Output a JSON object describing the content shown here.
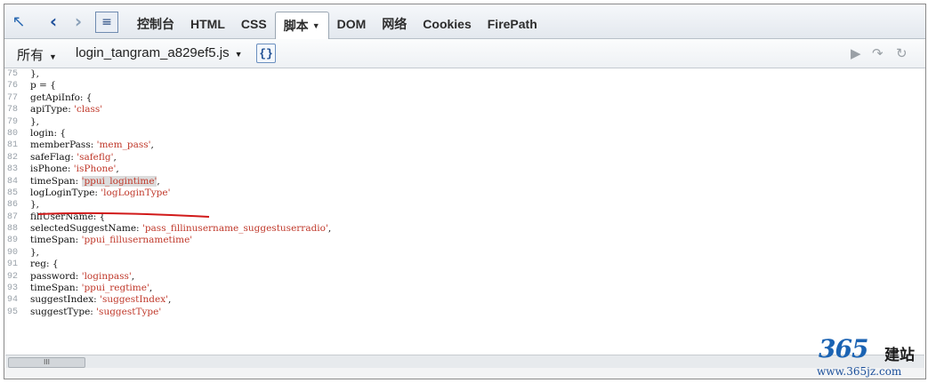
{
  "toolbar": {
    "icons": [
      "inspect-icon",
      "back-icon",
      "forward-icon",
      "command-line-icon"
    ],
    "tabs": [
      {
        "label": "控制台"
      },
      {
        "label": "HTML"
      },
      {
        "label": "CSS"
      },
      {
        "label": "脚本"
      },
      {
        "label": "DOM"
      },
      {
        "label": "网络"
      },
      {
        "label": "Cookies"
      },
      {
        "label": "FirePath"
      }
    ],
    "active_tab": "脚本"
  },
  "scriptbar": {
    "filter_label": "所有",
    "file_name": "login_tangram_a829ef5.js",
    "pretty_print_label": "{}",
    "controls": [
      "continue-icon",
      "step-over-icon",
      "step-into-icon"
    ]
  },
  "code": {
    "lines": [
      {
        "num": "75",
        "pre": "},",
        "str": "",
        "post": ""
      },
      {
        "num": "76",
        "pre": "p = {",
        "str": "",
        "post": ""
      },
      {
        "num": "77",
        "pre": "getApiInfo: {",
        "str": "",
        "post": ""
      },
      {
        "num": "78",
        "pre": "apiType: ",
        "str": "'class'",
        "post": ""
      },
      {
        "num": "79",
        "pre": "},",
        "str": "",
        "post": ""
      },
      {
        "num": "80",
        "pre": "login: {",
        "str": "",
        "post": ""
      },
      {
        "num": "81",
        "pre": "memberPass: ",
        "str": "'mem_pass'",
        "post": ","
      },
      {
        "num": "82",
        "pre": "safeFlag: ",
        "str": "'safeflg'",
        "post": ","
      },
      {
        "num": "83",
        "pre": "isPhone: ",
        "str": "'isPhone'",
        "post": ","
      },
      {
        "num": "84",
        "pre": "timeSpan: ",
        "str": "'ppui_logintime'",
        "post": ","
      },
      {
        "num": "85",
        "pre": "logLoginType: ",
        "str": "'logLoginType'",
        "post": ""
      },
      {
        "num": "86",
        "pre": "},",
        "str": "",
        "post": ""
      },
      {
        "num": "87",
        "pre": "fillUserName: {",
        "str": "",
        "post": ""
      },
      {
        "num": "88",
        "pre": "selectedSuggestName: ",
        "str": "'pass_fillinusername_suggestuserradio'",
        "post": ","
      },
      {
        "num": "89",
        "pre": "timeSpan: ",
        "str": "'ppui_fillusernametime'",
        "post": ""
      },
      {
        "num": "90",
        "pre": "},",
        "str": "",
        "post": ""
      },
      {
        "num": "91",
        "pre": "reg: {",
        "str": "",
        "post": ""
      },
      {
        "num": "92",
        "pre": "password: ",
        "str": "'loginpass'",
        "post": ","
      },
      {
        "num": "93",
        "pre": "timeSpan: ",
        "str": "'ppui_regtime'",
        "post": ","
      },
      {
        "num": "94",
        "pre": "suggestIndex: ",
        "str": "'suggestIndex'",
        "post": ","
      },
      {
        "num": "95",
        "pre": "suggestType: ",
        "str": "'suggestType'",
        "post": ""
      }
    ],
    "highlighted_line": "84"
  },
  "scrollbar": {
    "thumb_label": "III"
  },
  "watermark": {
    "number": "365",
    "chinese": "建站",
    "url": "www.365jz.com"
  },
  "colors": {
    "string": "#c0392b",
    "annotation": "#d11a1a",
    "watermark_blue": "#1b63b3"
  }
}
